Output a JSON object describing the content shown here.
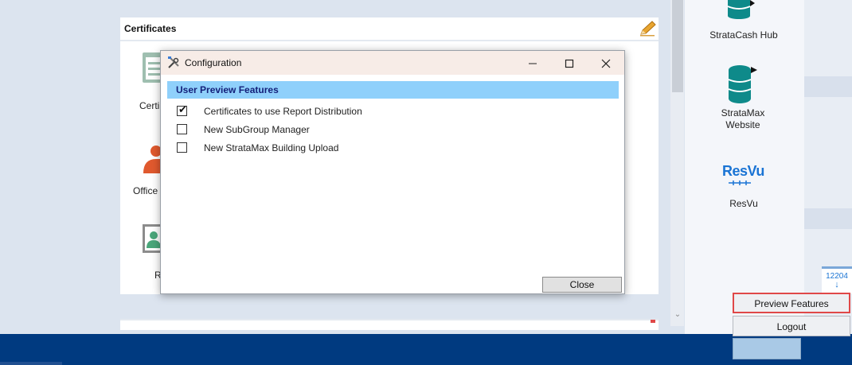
{
  "certificates_card": {
    "title": "Certificates",
    "partial_labels": [
      "Certi",
      "Office",
      "R"
    ]
  },
  "right_panel": {
    "apps": [
      {
        "label": "StrataCash Hub",
        "icon": "database-icon"
      },
      {
        "label": "StrataMax Website",
        "icon": "database-icon"
      },
      {
        "label": "ResVu",
        "icon": "resvu-logo"
      }
    ],
    "resvu_logo_text": "ResVu",
    "side_number": "12204"
  },
  "popup_menu": {
    "preview_label": "Preview Features",
    "logout_label": "Logout"
  },
  "dialog": {
    "title": "Configuration",
    "section_header": "User Preview Features",
    "options": [
      {
        "label": "Certificates to use Report Distribution",
        "checked": true
      },
      {
        "label": "New SubGroup Manager",
        "checked": false
      },
      {
        "label": "New StrataMax Building Upload",
        "checked": false
      }
    ],
    "close_label": "Close"
  },
  "colors": {
    "section_header_bg": "#8fd0fb",
    "taskbar": "#003a80",
    "highlight_border": "#e04848"
  }
}
